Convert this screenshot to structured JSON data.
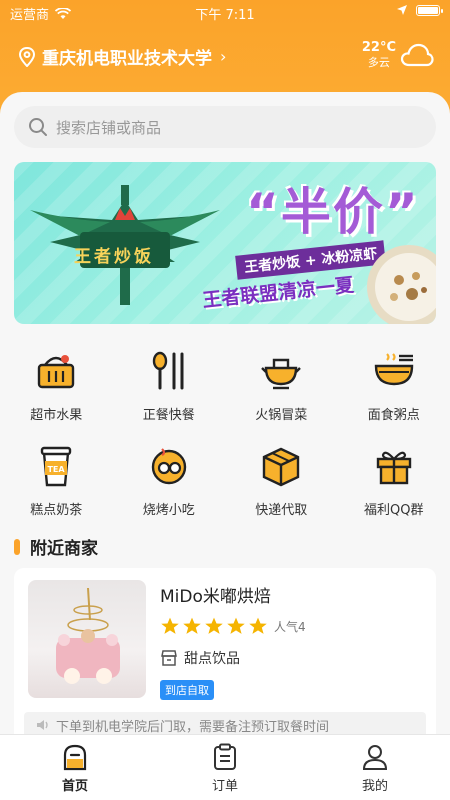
{
  "status_bar": {
    "carrier": "运营商",
    "time": "下午 7:11"
  },
  "header": {
    "location": "重庆机电职业技术大学",
    "weather_temp": "22°C",
    "weather_condition": "多云"
  },
  "search": {
    "placeholder": "搜索店铺或商品"
  },
  "banner": {
    "logo_text": "王者炒饭",
    "headline": "“半价”",
    "subline": "王者炒饭 + 冰粉凉虾",
    "slogan": "王者联盟清凉一夏"
  },
  "categories": [
    {
      "label": "超市水果",
      "icon": "basket-icon"
    },
    {
      "label": "正餐快餐",
      "icon": "spoon-chopsticks-icon"
    },
    {
      "label": "火锅冒菜",
      "icon": "hotpot-icon"
    },
    {
      "label": "面食粥点",
      "icon": "noodle-bowl-icon"
    },
    {
      "label": "糕点奶茶",
      "icon": "tea-cup-icon"
    },
    {
      "label": "烧烤小吃",
      "icon": "bbq-icon"
    },
    {
      "label": "快递代取",
      "icon": "package-icon"
    },
    {
      "label": "福利QQ群",
      "icon": "gift-icon"
    }
  ],
  "nearby": {
    "title": "附近商家",
    "merchants": [
      {
        "name": "MiDo米嘟烘焙",
        "rating": 5,
        "popularity": "人气4",
        "category": "甜点饮品",
        "tag": "到店自取",
        "notice": "下单到机电学院后门取，需要备注预订取餐时间"
      }
    ]
  },
  "tabbar": {
    "home": "首页",
    "orders": "订单",
    "mine": "我的"
  },
  "colors": {
    "accent": "#fba32a",
    "tag_blue": "#2a8ff7",
    "star": "#f5b400"
  }
}
